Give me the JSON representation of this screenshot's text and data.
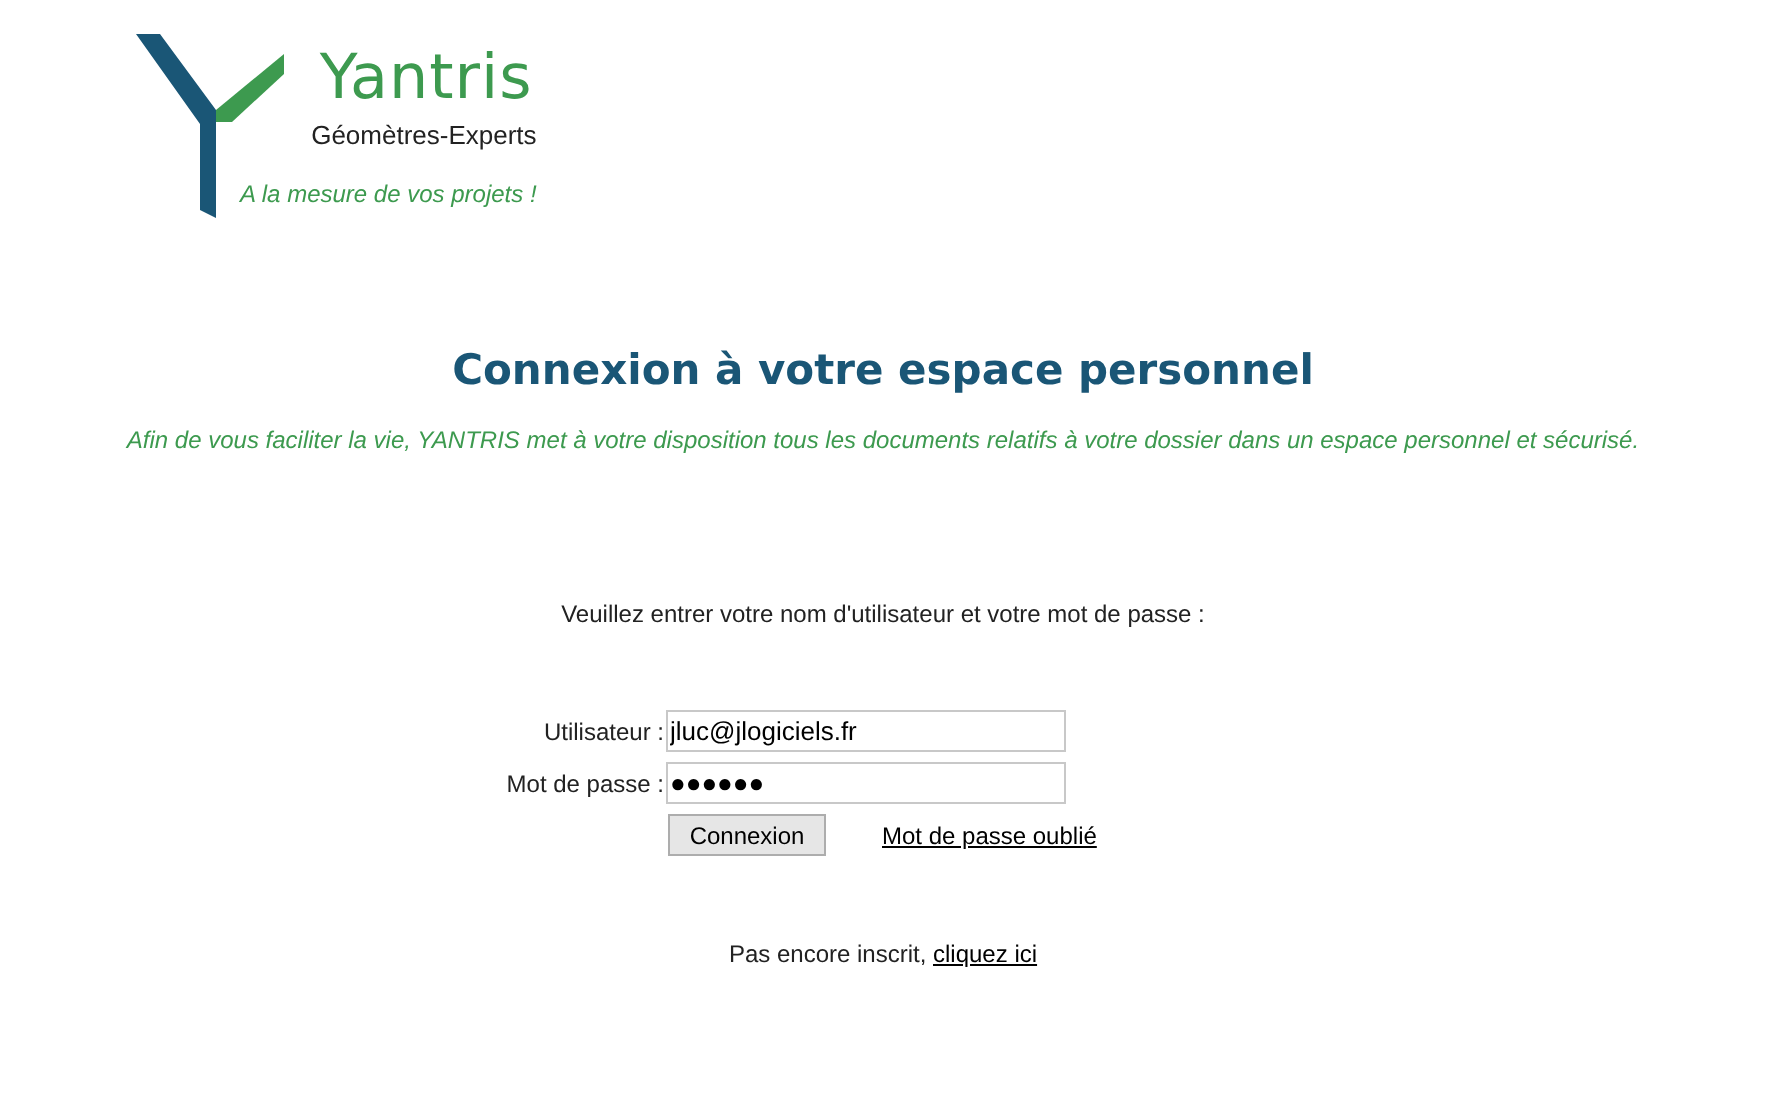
{
  "logo": {
    "brand": "Yantris",
    "subtitle": "Géomètres-Experts",
    "tagline": "A la mesure de vos projets !"
  },
  "heading": "Connexion à votre espace personnel",
  "intro": "Afin de vous faciliter la vie, YANTRIS met à votre disposition tous les documents relatifs à votre dossier dans un espace personnel et sécurisé.",
  "prompt": "Veuillez entrer votre nom d'utilisateur et votre mot de passe :",
  "fields": [
    {
      "label": "Utilisateur :",
      "value": "jluc@jlogiciels.fr"
    },
    {
      "label": "Mot de passe :",
      "value": "●●●●●●"
    }
  ],
  "login_button": "Connexion",
  "forgot_link": "Mot de passe oublié",
  "signup": {
    "text": "Pas encore inscrit,",
    "link": "cliquez ici"
  }
}
